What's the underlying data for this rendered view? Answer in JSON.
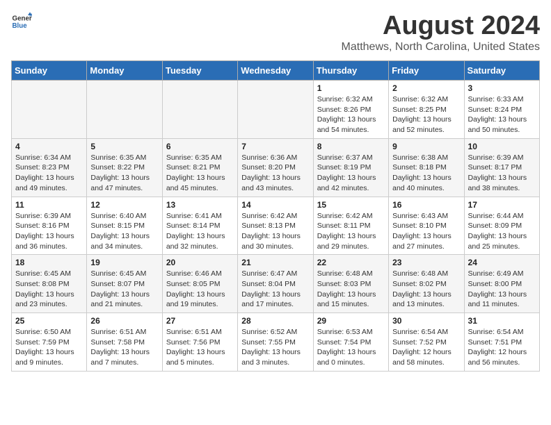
{
  "header": {
    "logo_line1": "General",
    "logo_line2": "Blue",
    "main_title": "August 2024",
    "subtitle": "Matthews, North Carolina, United States"
  },
  "calendar": {
    "days_of_week": [
      "Sunday",
      "Monday",
      "Tuesday",
      "Wednesday",
      "Thursday",
      "Friday",
      "Saturday"
    ],
    "weeks": [
      [
        {
          "day": "",
          "info": ""
        },
        {
          "day": "",
          "info": ""
        },
        {
          "day": "",
          "info": ""
        },
        {
          "day": "",
          "info": ""
        },
        {
          "day": "1",
          "info": "Sunrise: 6:32 AM\nSunset: 8:26 PM\nDaylight: 13 hours\nand 54 minutes."
        },
        {
          "day": "2",
          "info": "Sunrise: 6:32 AM\nSunset: 8:25 PM\nDaylight: 13 hours\nand 52 minutes."
        },
        {
          "day": "3",
          "info": "Sunrise: 6:33 AM\nSunset: 8:24 PM\nDaylight: 13 hours\nand 50 minutes."
        }
      ],
      [
        {
          "day": "4",
          "info": "Sunrise: 6:34 AM\nSunset: 8:23 PM\nDaylight: 13 hours\nand 49 minutes."
        },
        {
          "day": "5",
          "info": "Sunrise: 6:35 AM\nSunset: 8:22 PM\nDaylight: 13 hours\nand 47 minutes."
        },
        {
          "day": "6",
          "info": "Sunrise: 6:35 AM\nSunset: 8:21 PM\nDaylight: 13 hours\nand 45 minutes."
        },
        {
          "day": "7",
          "info": "Sunrise: 6:36 AM\nSunset: 8:20 PM\nDaylight: 13 hours\nand 43 minutes."
        },
        {
          "day": "8",
          "info": "Sunrise: 6:37 AM\nSunset: 8:19 PM\nDaylight: 13 hours\nand 42 minutes."
        },
        {
          "day": "9",
          "info": "Sunrise: 6:38 AM\nSunset: 8:18 PM\nDaylight: 13 hours\nand 40 minutes."
        },
        {
          "day": "10",
          "info": "Sunrise: 6:39 AM\nSunset: 8:17 PM\nDaylight: 13 hours\nand 38 minutes."
        }
      ],
      [
        {
          "day": "11",
          "info": "Sunrise: 6:39 AM\nSunset: 8:16 PM\nDaylight: 13 hours\nand 36 minutes."
        },
        {
          "day": "12",
          "info": "Sunrise: 6:40 AM\nSunset: 8:15 PM\nDaylight: 13 hours\nand 34 minutes."
        },
        {
          "day": "13",
          "info": "Sunrise: 6:41 AM\nSunset: 8:14 PM\nDaylight: 13 hours\nand 32 minutes."
        },
        {
          "day": "14",
          "info": "Sunrise: 6:42 AM\nSunset: 8:13 PM\nDaylight: 13 hours\nand 30 minutes."
        },
        {
          "day": "15",
          "info": "Sunrise: 6:42 AM\nSunset: 8:11 PM\nDaylight: 13 hours\nand 29 minutes."
        },
        {
          "day": "16",
          "info": "Sunrise: 6:43 AM\nSunset: 8:10 PM\nDaylight: 13 hours\nand 27 minutes."
        },
        {
          "day": "17",
          "info": "Sunrise: 6:44 AM\nSunset: 8:09 PM\nDaylight: 13 hours\nand 25 minutes."
        }
      ],
      [
        {
          "day": "18",
          "info": "Sunrise: 6:45 AM\nSunset: 8:08 PM\nDaylight: 13 hours\nand 23 minutes."
        },
        {
          "day": "19",
          "info": "Sunrise: 6:45 AM\nSunset: 8:07 PM\nDaylight: 13 hours\nand 21 minutes."
        },
        {
          "day": "20",
          "info": "Sunrise: 6:46 AM\nSunset: 8:05 PM\nDaylight: 13 hours\nand 19 minutes."
        },
        {
          "day": "21",
          "info": "Sunrise: 6:47 AM\nSunset: 8:04 PM\nDaylight: 13 hours\nand 17 minutes."
        },
        {
          "day": "22",
          "info": "Sunrise: 6:48 AM\nSunset: 8:03 PM\nDaylight: 13 hours\nand 15 minutes."
        },
        {
          "day": "23",
          "info": "Sunrise: 6:48 AM\nSunset: 8:02 PM\nDaylight: 13 hours\nand 13 minutes."
        },
        {
          "day": "24",
          "info": "Sunrise: 6:49 AM\nSunset: 8:00 PM\nDaylight: 13 hours\nand 11 minutes."
        }
      ],
      [
        {
          "day": "25",
          "info": "Sunrise: 6:50 AM\nSunset: 7:59 PM\nDaylight: 13 hours\nand 9 minutes."
        },
        {
          "day": "26",
          "info": "Sunrise: 6:51 AM\nSunset: 7:58 PM\nDaylight: 13 hours\nand 7 minutes."
        },
        {
          "day": "27",
          "info": "Sunrise: 6:51 AM\nSunset: 7:56 PM\nDaylight: 13 hours\nand 5 minutes."
        },
        {
          "day": "28",
          "info": "Sunrise: 6:52 AM\nSunset: 7:55 PM\nDaylight: 13 hours\nand 3 minutes."
        },
        {
          "day": "29",
          "info": "Sunrise: 6:53 AM\nSunset: 7:54 PM\nDaylight: 13 hours\nand 0 minutes."
        },
        {
          "day": "30",
          "info": "Sunrise: 6:54 AM\nSunset: 7:52 PM\nDaylight: 12 hours\nand 58 minutes."
        },
        {
          "day": "31",
          "info": "Sunrise: 6:54 AM\nSunset: 7:51 PM\nDaylight: 12 hours\nand 56 minutes."
        }
      ]
    ]
  }
}
